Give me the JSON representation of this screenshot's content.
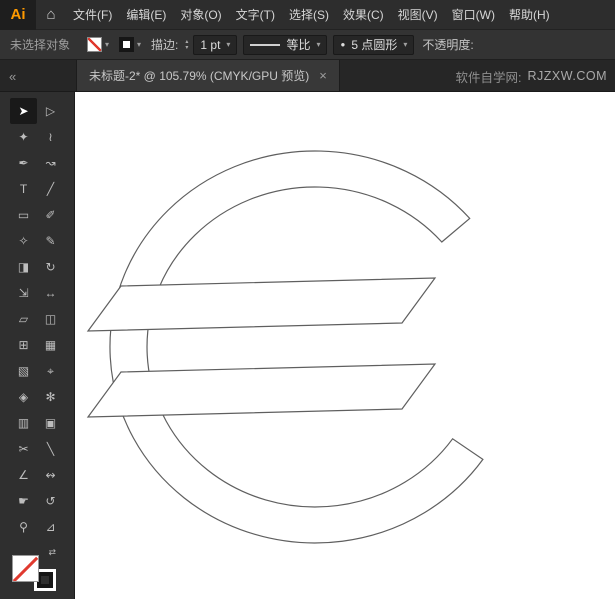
{
  "app": {
    "logo_text": "Ai"
  },
  "colors": {
    "brand": "#ff9a00",
    "none_indicator": "#e03a2f",
    "ui_dark": "#2f2f2f"
  },
  "icons": {
    "home": "⌂",
    "chevron_down": "▾",
    "spinner_up": "▴",
    "spinner_down": "▾",
    "swap": "⇄",
    "collapse": "«",
    "close": "×",
    "brush_dot": "●"
  },
  "menu_bar": {
    "items": [
      "文件(F)",
      "编辑(E)",
      "对象(O)",
      "文字(T)",
      "选择(S)",
      "效果(C)",
      "视图(V)",
      "窗口(W)",
      "帮助(H)"
    ]
  },
  "control_bar": {
    "status": "未选择对象",
    "stroke_label": "描边:",
    "stroke_weight": "1 pt",
    "width_profile": "等比",
    "brush_name": "5 点圆形",
    "opacity_label": "不透明度:"
  },
  "tab_bar": {
    "tab_title": "未标题-2* @ 105.79% (CMYK/GPU 预览)",
    "watermark_site": "软件自学网:",
    "watermark_domain": "RJZXW.COM"
  },
  "toolbar": {
    "tools": [
      {
        "name": "selection-tool",
        "glyph": "➤",
        "selected": true
      },
      {
        "name": "direct-selection-tool",
        "glyph": "▷"
      },
      {
        "name": "magic-wand-tool",
        "glyph": "✦"
      },
      {
        "name": "lasso-tool",
        "glyph": "≀"
      },
      {
        "name": "pen-tool",
        "glyph": "✒"
      },
      {
        "name": "curvature-tool",
        "glyph": "↝"
      },
      {
        "name": "type-tool",
        "glyph": "T"
      },
      {
        "name": "line-segment-tool",
        "glyph": "╱"
      },
      {
        "name": "rectangle-tool",
        "glyph": "▭"
      },
      {
        "name": "paintbrush-tool",
        "glyph": "✐"
      },
      {
        "name": "shaper-tool",
        "glyph": "✧"
      },
      {
        "name": "pencil-tool",
        "glyph": "✎"
      },
      {
        "name": "eraser-tool",
        "glyph": "◨"
      },
      {
        "name": "rotate-tool",
        "glyph": "↻"
      },
      {
        "name": "scale-tool",
        "glyph": "⇲"
      },
      {
        "name": "width-tool",
        "glyph": "↔"
      },
      {
        "name": "free-transform-tool",
        "glyph": "▱"
      },
      {
        "name": "shape-builder-tool",
        "glyph": "◫"
      },
      {
        "name": "perspective-grid-tool",
        "glyph": "⊞"
      },
      {
        "name": "mesh-tool",
        "glyph": "▦"
      },
      {
        "name": "gradient-tool",
        "glyph": "▧"
      },
      {
        "name": "eyedropper-tool",
        "glyph": "⌖"
      },
      {
        "name": "blend-tool",
        "glyph": "◈"
      },
      {
        "name": "symbol-sprayer-tool",
        "glyph": "✻"
      },
      {
        "name": "column-graph-tool",
        "glyph": "▥"
      },
      {
        "name": "artboard-tool",
        "glyph": "▣"
      },
      {
        "name": "slice-tool",
        "glyph": "✂"
      },
      {
        "name": "knife-tool",
        "glyph": "╲"
      },
      {
        "name": "shear-tool",
        "glyph": "∠"
      },
      {
        "name": "reshape-tool",
        "glyph": "↭"
      },
      {
        "name": "hand-tool",
        "glyph": "☛"
      },
      {
        "name": "rotate-view-tool",
        "glyph": "↺"
      },
      {
        "name": "zoom-tool",
        "glyph": "⚲"
      },
      {
        "name": "measure-tool",
        "glyph": "⊿"
      }
    ]
  },
  "canvas": {
    "shape": "euro-sign-outline",
    "fill": "none",
    "stroke": "black 1pt"
  }
}
